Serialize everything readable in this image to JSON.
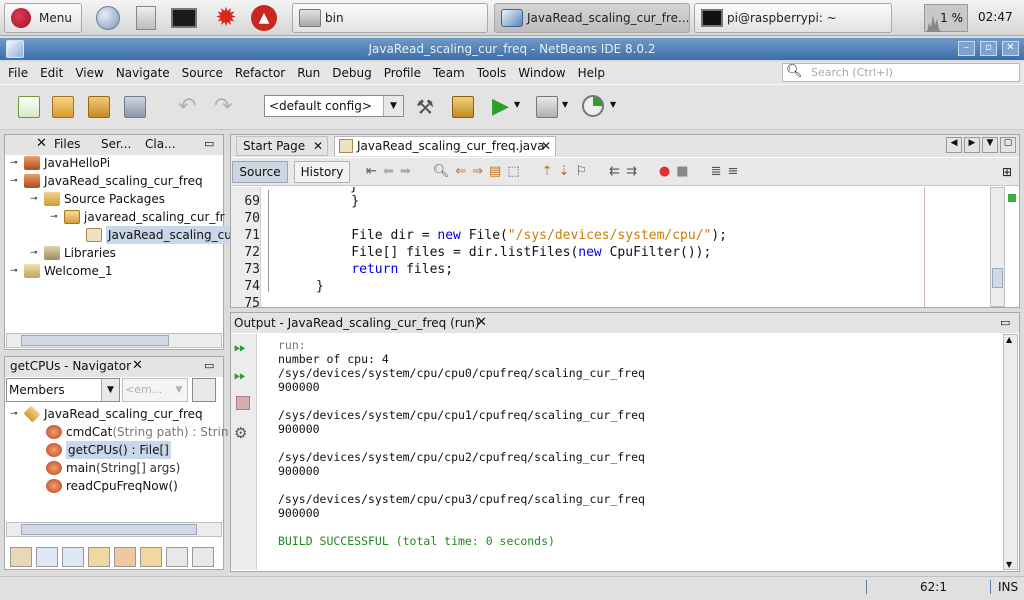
{
  "taskbar": {
    "menu_label": "Menu",
    "tasks": [
      {
        "label": "bin",
        "icon": "folder-icon"
      },
      {
        "label": "JavaRead_scaling_cur_fre...",
        "icon": "netbeans-icon"
      },
      {
        "label": "pi@raspberrypi: ~",
        "icon": "terminal-icon"
      }
    ],
    "cpu_percent": "1 %",
    "clock": "02:47"
  },
  "window": {
    "title": "JavaRead_scaling_cur_freq - NetBeans IDE 8.0.2"
  },
  "menubar": [
    "File",
    "Edit",
    "View",
    "Navigate",
    "Source",
    "Refactor",
    "Run",
    "Debug",
    "Profile",
    "Team",
    "Tools",
    "Window",
    "Help"
  ],
  "search": {
    "placeholder": "Search (Ctrl+I)"
  },
  "toolbar": {
    "config": "<default config>"
  },
  "projects_panel": {
    "tabs": [
      "Files",
      "Ser...",
      "Cla..."
    ],
    "tree": [
      {
        "label": "JavaHelloPi",
        "depth": 0
      },
      {
        "label": "JavaRead_scaling_cur_freq",
        "depth": 0
      },
      {
        "label": "Source Packages",
        "depth": 1
      },
      {
        "label": "javaread_scaling_cur_fr",
        "depth": 2
      },
      {
        "label": "JavaRead_scaling_cu",
        "depth": 3
      },
      {
        "label": "Libraries",
        "depth": 1
      },
      {
        "label": "Welcome_1",
        "depth": 0
      }
    ]
  },
  "navigator": {
    "title": "getCPUs - Navigator",
    "filter": "Members",
    "filter2": "<em...",
    "tree": [
      {
        "label": "JavaRead_scaling_cur_freq"
      },
      {
        "label": "cmdCat",
        "sig": "(String path) : Strin"
      },
      {
        "label": "getCPUs() : File[]",
        "sig": ""
      },
      {
        "label": "main",
        "sig": "(String[] args)"
      },
      {
        "label": "readCpuFreqNow()",
        "sig": ""
      }
    ]
  },
  "editor": {
    "tabs": [
      "Start Page",
      "JavaRead_scaling_cur_freq.java"
    ],
    "source_label": "Source",
    "history_label": "History",
    "lines": [
      {
        "n": "69",
        "text": "    }"
      },
      {
        "n": "70",
        "text": ""
      },
      {
        "n": "71",
        "pre": "    File dir = ",
        "kw": "new",
        "mid": " File(",
        "str": "\"/sys/devices/system/cpu/\"",
        "post": ");"
      },
      {
        "n": "72",
        "pre": "    File[] files = dir.listFiles(",
        "kw": "new",
        "mid": " CpuFilter());",
        "str": "",
        "post": ""
      },
      {
        "n": "73",
        "pre": "    ",
        "kw": "return",
        "mid": " files;",
        "str": "",
        "post": ""
      },
      {
        "n": "74",
        "text": "}"
      },
      {
        "n": "75",
        "text": ""
      }
    ]
  },
  "output": {
    "title": "Output - JavaRead_scaling_cur_freq (run)",
    "lines": [
      "run:",
      "number of cpu: 4",
      "/sys/devices/system/cpu/cpu0/cpufreq/scaling_cur_freq",
      "900000",
      "",
      "/sys/devices/system/cpu/cpu1/cpufreq/scaling_cur_freq",
      "900000",
      "",
      "/sys/devices/system/cpu/cpu2/cpufreq/scaling_cur_freq",
      "900000",
      "",
      "/sys/devices/system/cpu/cpu3/cpufreq/scaling_cur_freq",
      "900000",
      "",
      "BUILD SUCCESSFUL (total time: 0 seconds)"
    ]
  },
  "status": {
    "position": "62:1",
    "mode": "INS"
  }
}
